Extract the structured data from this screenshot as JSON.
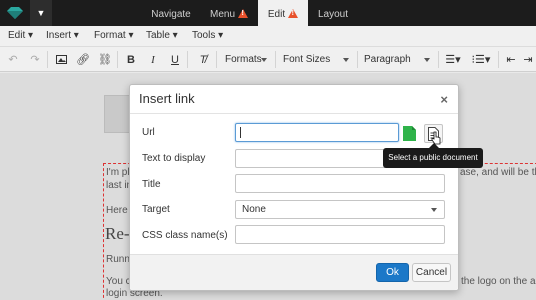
{
  "nav": {
    "tabs": [
      {
        "label": "Navigate"
      },
      {
        "label": "Menu",
        "warning": true
      },
      {
        "label": "Edit",
        "warning": true,
        "active": true
      },
      {
        "label": "Layout"
      }
    ]
  },
  "menubar": {
    "items": [
      "Edit",
      "Insert",
      "Format",
      "Table",
      "Tools"
    ]
  },
  "toolbar": {
    "formats": "Formats",
    "font_sizes": "Font Sizes",
    "paragraph": "Paragraph"
  },
  "editor": {
    "line1_start": "I'm pl",
    "line1_end": "ase, and will be th",
    "line2": "last in",
    "line3": "Here",
    "heading": "Re-",
    "line4": "Runni",
    "line5_start": "You c",
    "line5_end": "the logo on the ad",
    "line6": "login screen."
  },
  "dialog": {
    "title": "Insert link",
    "close": "×",
    "fields": {
      "url_label": "Url",
      "url_value": "",
      "text_label": "Text to display",
      "text_value": "",
      "title_label": "Title",
      "title_value": "",
      "target_label": "Target",
      "target_value": "None",
      "class_label": "CSS class name(s)",
      "class_value": ""
    },
    "ok": "Ok",
    "cancel": "Cancel"
  },
  "tooltip": "Select a public document",
  "colors": {
    "accent": "#1b78c8",
    "warning": "#e8512b",
    "file_green": "#2fb34a"
  }
}
